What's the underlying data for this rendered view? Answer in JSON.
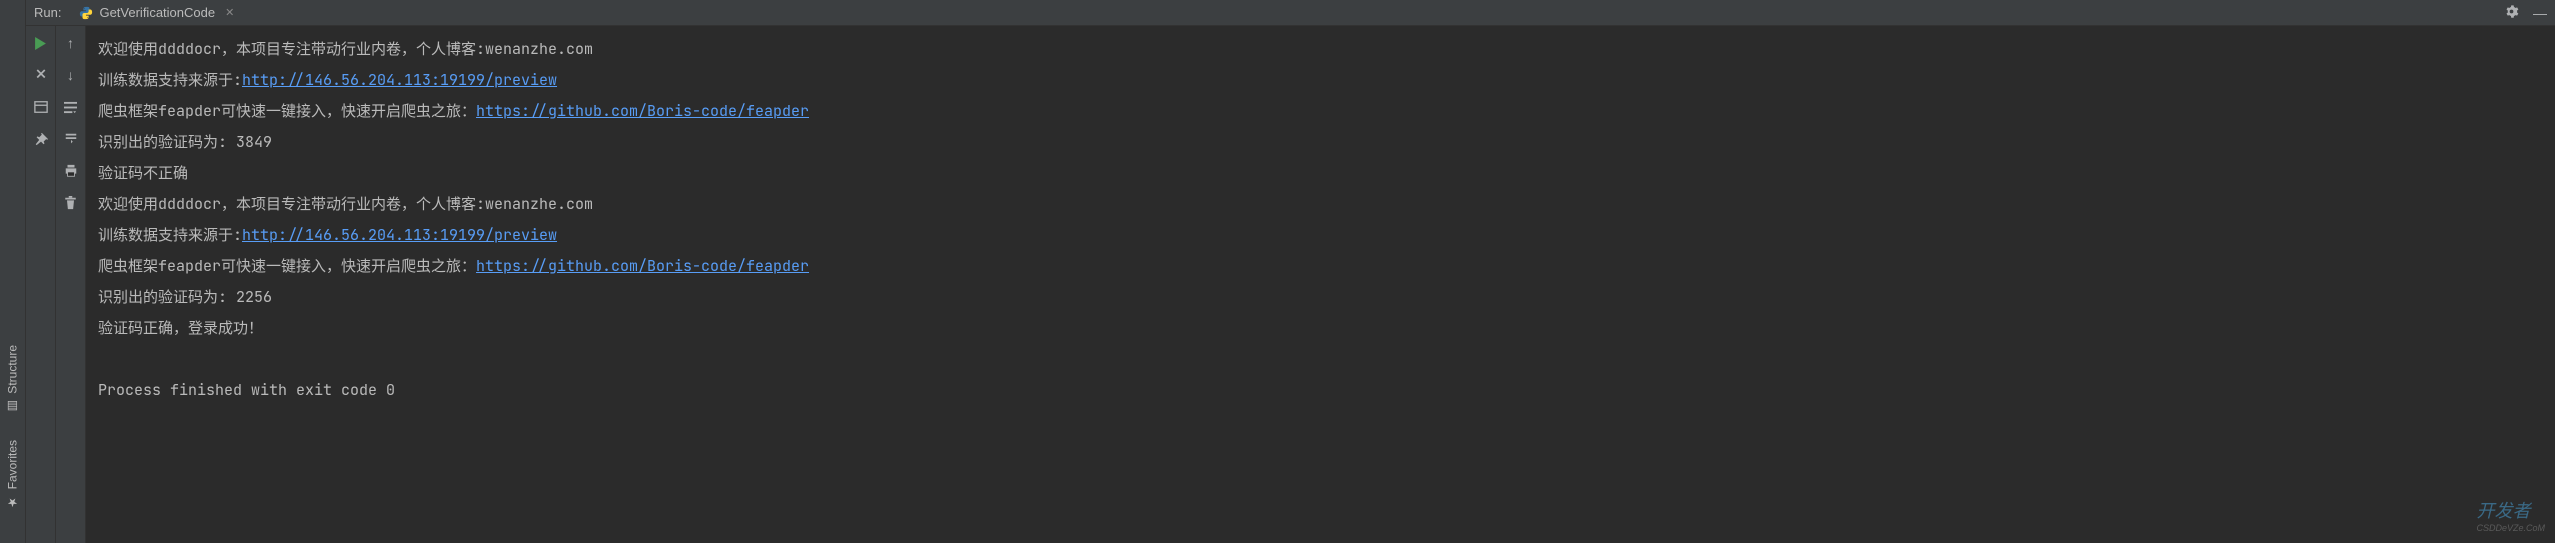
{
  "side_tabs": {
    "structure": "Structure",
    "favorites": "Favorites"
  },
  "header": {
    "run_label": "Run:",
    "tab_name": "GetVerificationCode"
  },
  "console": {
    "lines": [
      {
        "type": "text",
        "pre": "欢迎使用ddddocr，本项目专注带动行业内卷，个人博客:wenanzhe.com"
      },
      {
        "type": "link_line",
        "pre": "训练数据支持来源于:",
        "link": "http://146.56.204.113:19199/preview"
      },
      {
        "type": "link_line",
        "pre": "爬虫框架feapder可快速一键接入，快速开启爬虫之旅：",
        "link": "https://github.com/Boris-code/feapder"
      },
      {
        "type": "text",
        "pre": "识别出的验证码为: 3849"
      },
      {
        "type": "text",
        "pre": "验证码不正确"
      },
      {
        "type": "text",
        "pre": "欢迎使用ddddocr，本项目专注带动行业内卷，个人博客:wenanzhe.com"
      },
      {
        "type": "link_line",
        "pre": "训练数据支持来源于:",
        "link": "http://146.56.204.113:19199/preview"
      },
      {
        "type": "link_line",
        "pre": "爬虫框架feapder可快速一键接入，快速开启爬虫之旅：",
        "link": "https://github.com/Boris-code/feapder"
      },
      {
        "type": "text",
        "pre": "识别出的验证码为: 2256"
      },
      {
        "type": "text",
        "pre": "验证码正确，登录成功！"
      },
      {
        "type": "blank"
      },
      {
        "type": "text",
        "pre": "Process finished with exit code 0"
      }
    ]
  },
  "watermark": {
    "main": "开发者",
    "sub": "CSDDeVZe.CoM"
  }
}
